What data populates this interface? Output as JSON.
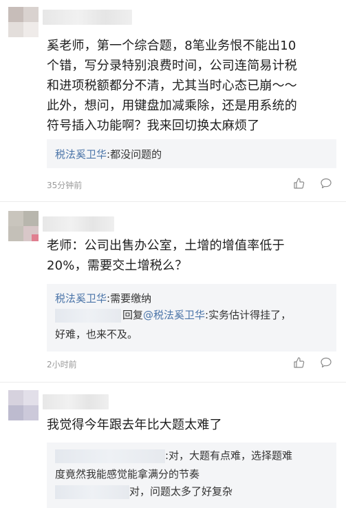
{
  "comments": [
    {
      "text_lines": [
        "奚老师，第一个综合题，8笔业务恨不能出10",
        "个错，写分录特别浪费时间，公司连简易计税",
        "和进项税额都分不清，尤其当时心态已崩～～",
        "此外，想问，用键盘加减乘除，还是用系统的",
        "符号插入功能啊？我来回切换太麻烦了"
      ],
      "replies": [
        {
          "author": "税法奚卫华",
          "sep": ":",
          "text": "都没问题的"
        }
      ],
      "time": "35分钟前"
    },
    {
      "text_lines": [
        "老师：公司出售办公室，土增的增值率低于",
        "20%，需要交土增税么？"
      ],
      "replies": [
        {
          "author": "税法奚卫华",
          "sep": ":",
          "text": "需要缴纳"
        },
        {
          "prefix": "回复",
          "author": "@税法奚卫华",
          "sep": ":",
          "text": "实务估计得挂了，",
          "continuation": "好难，也来不及。"
        }
      ],
      "time": "2小时前"
    },
    {
      "text_lines": [
        "我觉得今年跟去年比大题太难了"
      ],
      "replies": [
        {
          "text": ":对，大题有点难，选择题难",
          "continuation": "度竟然我能感觉能拿满分的节奏"
        },
        {
          "text": "对，问题太多了好复杂"
        }
      ]
    }
  ],
  "icons": {
    "like": "thumbs-up-icon",
    "reply": "comment-bubble-icon"
  },
  "colors": {
    "author": "#4a74a8",
    "reply_bg": "#f4f5f7",
    "meta": "#9a9a9a"
  }
}
